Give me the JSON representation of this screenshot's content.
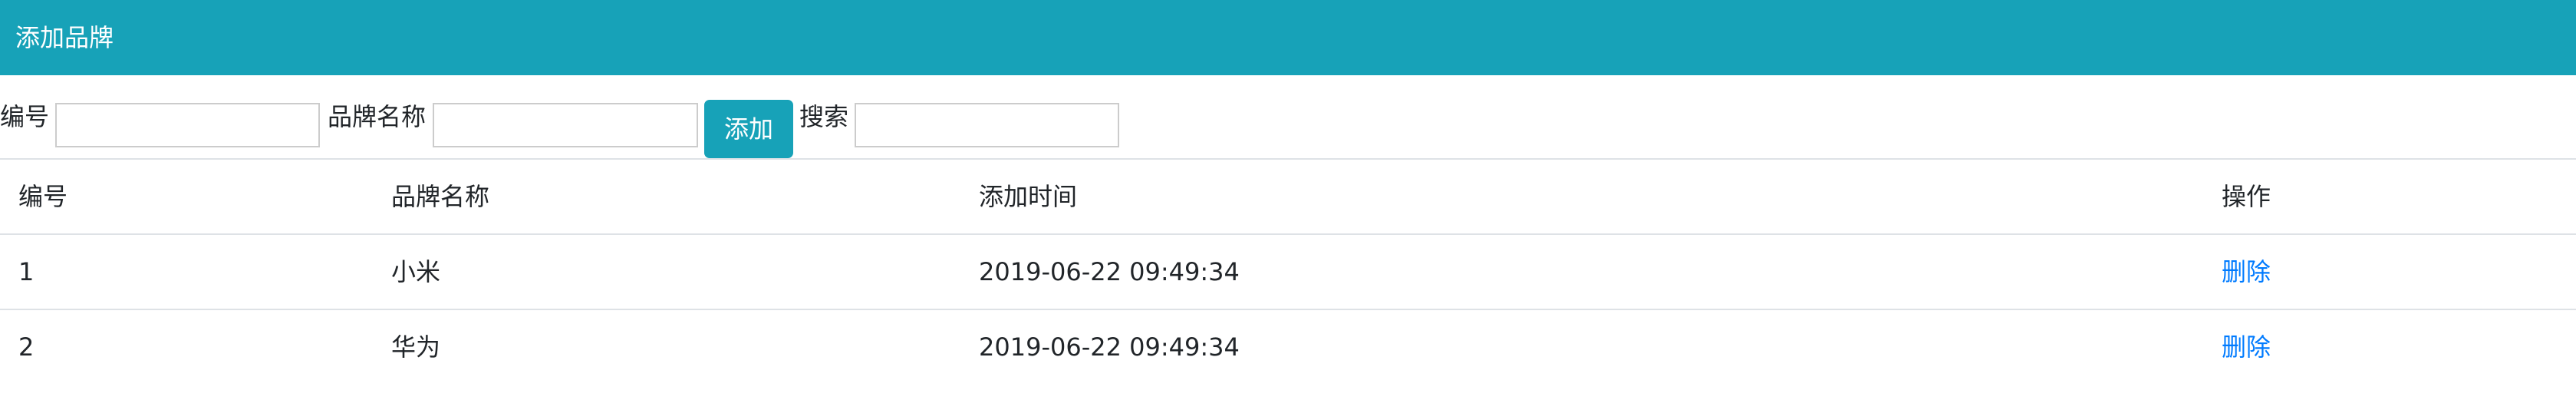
{
  "header": {
    "title": "添加品牌"
  },
  "form": {
    "id_label": "编号",
    "id_value": "",
    "name_label": "品牌名称",
    "name_value": "",
    "add_button": "添加",
    "search_label": "搜索",
    "search_value": ""
  },
  "table": {
    "columns": [
      "编号",
      "品牌名称",
      "添加时间",
      "操作"
    ],
    "rows": [
      {
        "id": "1",
        "name": "小米",
        "time": "2019-06-22 09:49:34",
        "action": "删除"
      },
      {
        "id": "2",
        "name": "华为",
        "time": "2019-06-22 09:49:34",
        "action": "删除"
      }
    ]
  },
  "colors": {
    "accent": "#17a2b8",
    "link": "#007bff",
    "border": "#dee2e6"
  }
}
